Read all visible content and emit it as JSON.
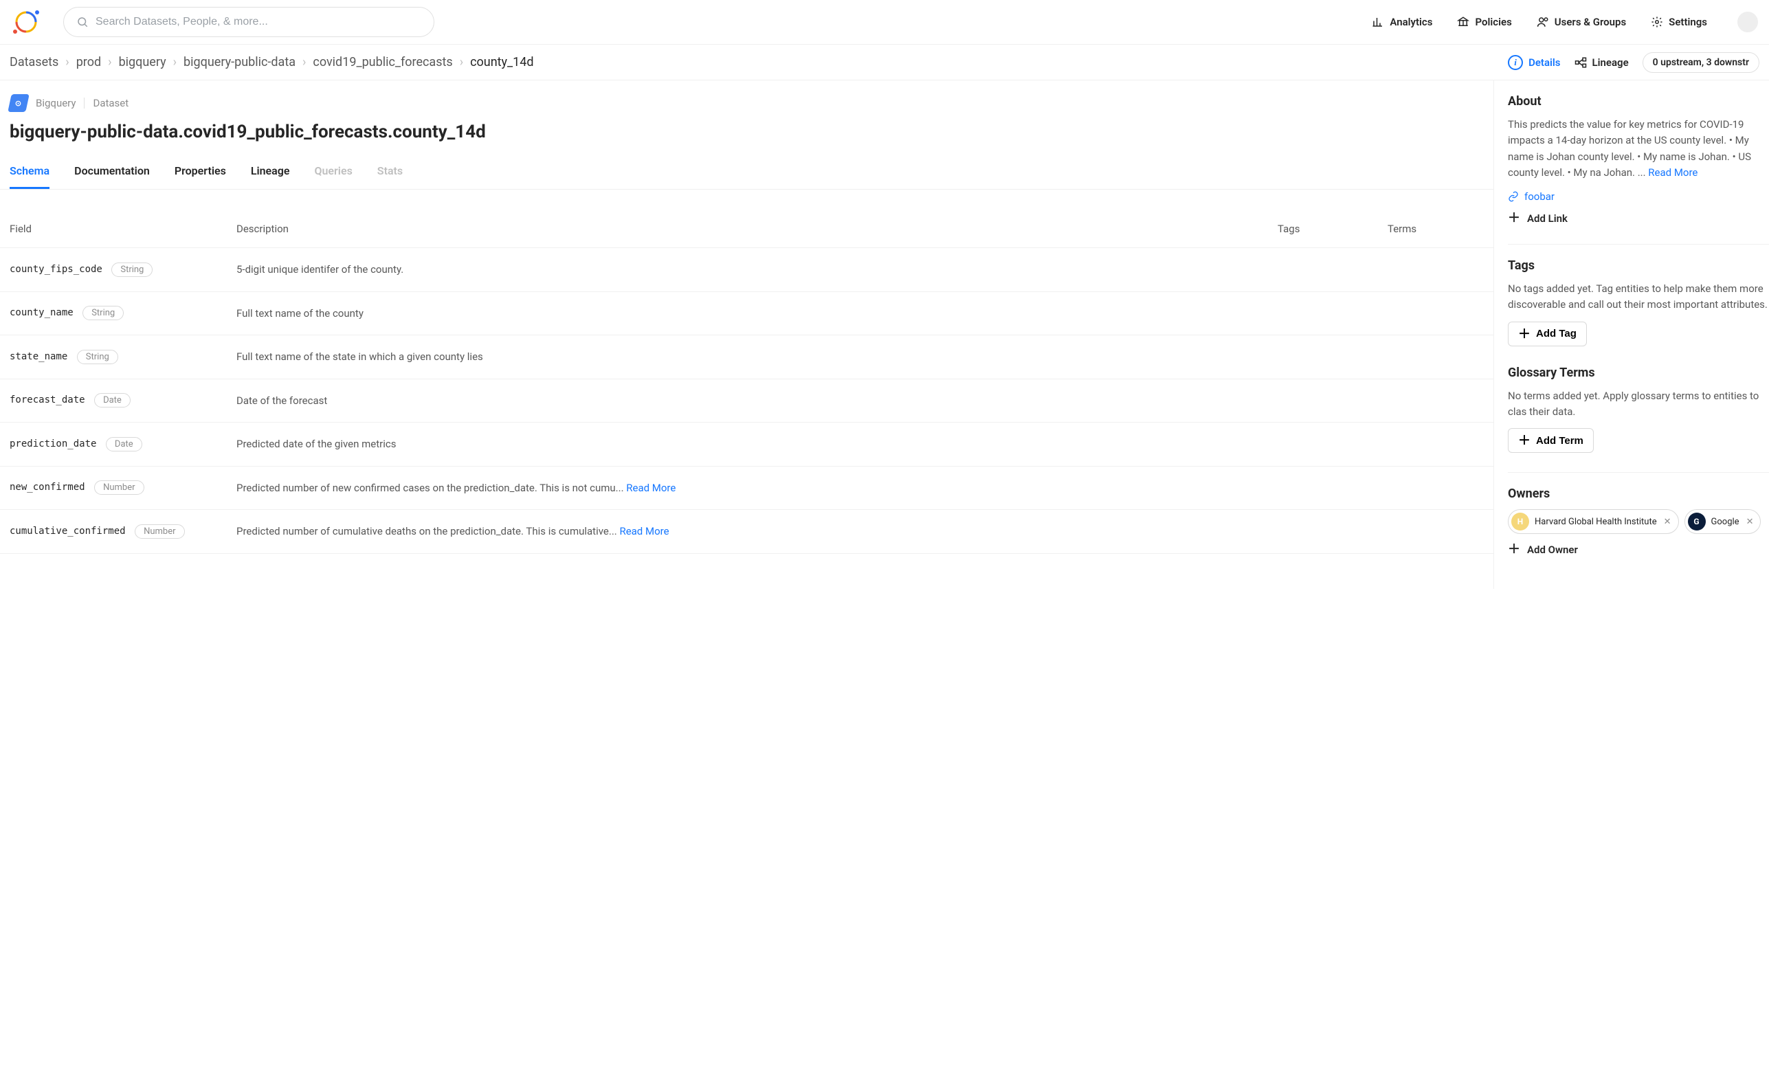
{
  "search": {
    "placeholder": "Search Datasets, People, & more..."
  },
  "nav": {
    "analytics": "Analytics",
    "policies": "Policies",
    "users_groups": "Users & Groups",
    "settings": "Settings"
  },
  "breadcrumb": {
    "items": [
      "Datasets",
      "prod",
      "bigquery",
      "bigquery-public-data",
      "covid19_public_forecasts",
      "county_14d"
    ]
  },
  "crumb_actions": {
    "details": "Details",
    "lineage": "Lineage",
    "stream_pill": "0 upstream, 3 downstr"
  },
  "entity": {
    "platform": "Bigquery",
    "type": "Dataset",
    "title": "bigquery-public-data.covid19_public_forecasts.county_14d"
  },
  "tabs": {
    "schema": "Schema",
    "documentation": "Documentation",
    "properties": "Properties",
    "lineage": "Lineage",
    "queries": "Queries",
    "stats": "Stats"
  },
  "schema": {
    "headers": {
      "field": "Field",
      "description": "Description",
      "tags": "Tags",
      "terms": "Terms"
    },
    "read_more": "Read More",
    "rows": [
      {
        "name": "county_fips_code",
        "type": "String",
        "desc": "5-digit unique identifer of the county.",
        "truncated": false
      },
      {
        "name": "county_name",
        "type": "String",
        "desc": "Full text name of the county",
        "truncated": false
      },
      {
        "name": "state_name",
        "type": "String",
        "desc": "Full text name of the state in which a given county lies",
        "truncated": false
      },
      {
        "name": "forecast_date",
        "type": "Date",
        "desc": "Date of the forecast",
        "truncated": false
      },
      {
        "name": "prediction_date",
        "type": "Date",
        "desc": "Predicted date of the given metrics",
        "truncated": false
      },
      {
        "name": "new_confirmed",
        "type": "Number",
        "desc": "Predicted number of new confirmed cases on the prediction_date. This is not cumu... ",
        "truncated": true
      },
      {
        "name": "cumulative_confirmed",
        "type": "Number",
        "desc": "Predicted number of cumulative deaths on the prediction_date. This is cumulative... ",
        "truncated": true
      }
    ]
  },
  "sidebar": {
    "about": {
      "title": "About",
      "text": "This predicts the value for key metrics for COVID-19 impacts a 14-day horizon at the US county level.  •  My name is Johan county level.  •  My name is Johan.  •  US county level.  •  My na Johan. ... ",
      "read_more": "Read More",
      "link_label": "foobar",
      "add_link": "Add Link"
    },
    "tags": {
      "title": "Tags",
      "empty": "No tags added yet. Tag entities to help make them more discoverable and call out their most important attributes.",
      "add": "Add Tag"
    },
    "glossary": {
      "title": "Glossary Terms",
      "empty": "No terms added yet. Apply glossary terms to entities to clas their data.",
      "add": "Add Term"
    },
    "owners": {
      "title": "Owners",
      "add": "Add Owner",
      "items": [
        {
          "name": "Harvard Global Health Institute",
          "initial": "H",
          "color": "#f5d77a"
        },
        {
          "name": "Google",
          "initial": "G",
          "color": "#0b1d3a"
        }
      ]
    }
  }
}
